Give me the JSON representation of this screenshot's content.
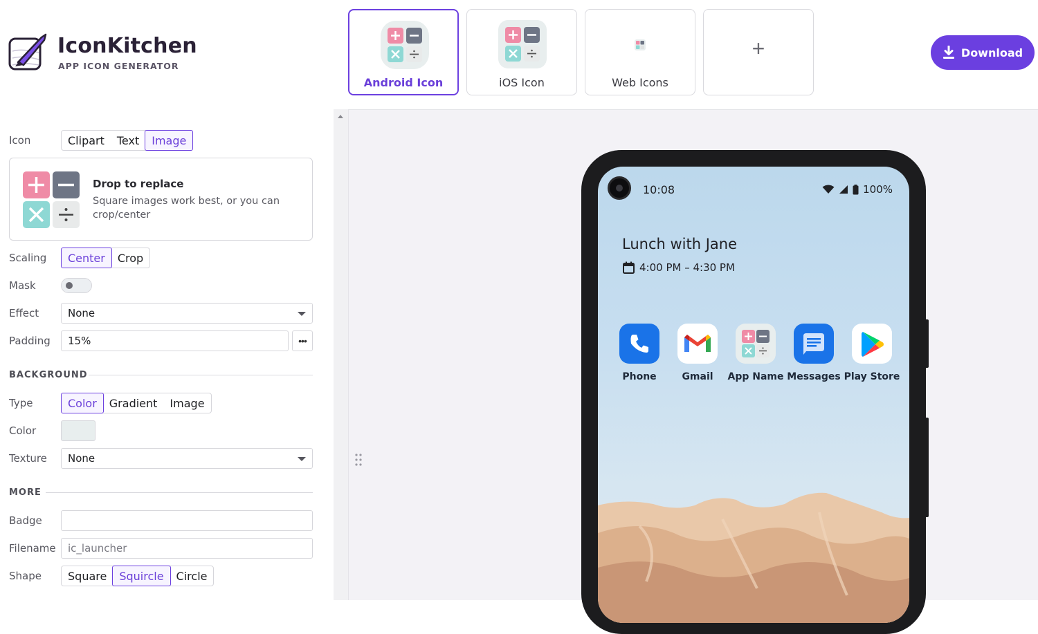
{
  "brand": {
    "title": "IconKitchen",
    "subtitle": "APP ICON GENERATOR"
  },
  "targets": [
    {
      "label": "Android Icon",
      "active": true
    },
    {
      "label": "iOS Icon",
      "active": false
    },
    {
      "label": "Web Icons",
      "active": false
    },
    {
      "label": "+",
      "active": false
    }
  ],
  "download": {
    "label": "Download"
  },
  "form": {
    "icon": {
      "label": "Icon",
      "options": [
        "Clipart",
        "Text",
        "Image"
      ],
      "selected": "Image"
    },
    "dropzone": {
      "title": "Drop to replace",
      "description": "Square images work best, or you can crop/center"
    },
    "scaling": {
      "label": "Scaling",
      "options": [
        "Center",
        "Crop"
      ],
      "selected": "Center"
    },
    "mask": {
      "label": "Mask",
      "on": false
    },
    "effect": {
      "label": "Effect",
      "value": "None"
    },
    "padding": {
      "label": "Padding",
      "value": "15%",
      "more": "•••"
    },
    "background": {
      "heading": "BACKGROUND",
      "type": {
        "label": "Type",
        "options": [
          "Color",
          "Gradient",
          "Image"
        ],
        "selected": "Color"
      },
      "color": {
        "label": "Color",
        "value": "#E8EEEE"
      },
      "texture": {
        "label": "Texture",
        "value": "None"
      }
    },
    "more": {
      "heading": "MORE",
      "badge": {
        "label": "Badge",
        "value": ""
      },
      "filename": {
        "label": "Filename",
        "placeholder": "ic_launcher"
      },
      "shape": {
        "label": "Shape",
        "options": [
          "Square",
          "Squircle",
          "Circle"
        ],
        "selected": "Squircle"
      }
    }
  },
  "preview": {
    "status": {
      "time": "10:08",
      "battery": "100%"
    },
    "event": {
      "title": "Lunch with Jane",
      "time": "4:00 PM – 4:30 PM"
    },
    "apps": [
      {
        "label": "Phone",
        "icon": "phone-icon"
      },
      {
        "label": "Gmail",
        "icon": "gmail-icon"
      },
      {
        "label": "App Name",
        "icon": "calculator-icon"
      },
      {
        "label": "Messages",
        "icon": "messages-icon"
      },
      {
        "label": "Play Store",
        "icon": "play-store-icon"
      }
    ]
  },
  "colors": {
    "accent": "#6B3FE0",
    "plus": "#EF8BA6",
    "minus": "#6E7585",
    "times": "#8ED8D4",
    "divide": "#E8EAEA"
  }
}
